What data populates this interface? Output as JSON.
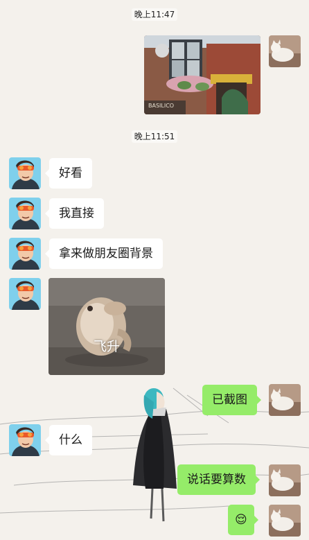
{
  "conversation": {
    "timestamps": [
      "晚上11:47",
      "晚上11:51"
    ],
    "messages": [
      {
        "sender": "friend",
        "type": "text",
        "text": "好看"
      },
      {
        "sender": "friend",
        "type": "text",
        "text": "我直接"
      },
      {
        "sender": "friend",
        "type": "text",
        "text": "拿来做朋友圈背景"
      },
      {
        "sender": "friend",
        "type": "sticker",
        "caption": "飞升"
      },
      {
        "sender": "me",
        "type": "text",
        "text": "已截图"
      },
      {
        "sender": "friend",
        "type": "text",
        "text": "什么"
      },
      {
        "sender": "me",
        "type": "text",
        "text": "说话要算数"
      },
      {
        "sender": "me",
        "type": "emoji",
        "text": "😌"
      }
    ],
    "photo_message": {
      "storefront_sign": "BASILICO"
    }
  },
  "colors": {
    "background": "#f4f1ec",
    "outgoing_bubble": "#95ec69",
    "incoming_bubble": "#ffffff"
  },
  "icons": {
    "friend_avatar": "anime-boy-with-goggles",
    "my_avatar": "white-cat",
    "background_art": "girl-in-black-cloak"
  }
}
